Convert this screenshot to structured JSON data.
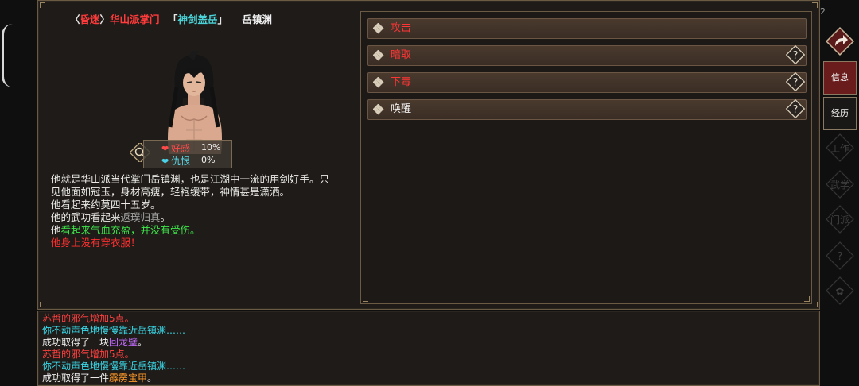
{
  "header": {
    "bracket_open": "〈",
    "status": "昏迷",
    "bracket_close": "〉",
    "sect_position": "华山派掌门",
    "title_open": "「",
    "title": "神剑盖岳",
    "title_close": "」",
    "name": "岳镇渊"
  },
  "stats": {
    "favor_label": "好感",
    "favor_value": "10%",
    "hatred_label": "仇恨",
    "hatred_value": "0%"
  },
  "description": {
    "intro": "他就是华山派当代掌门岳镇渊，也是江湖中一流的用剑好手。只见他面如冠玉，身材高瘦，轻袍缓带，神情甚是潇洒。",
    "age": "他看起来约莫四十五岁。",
    "martial_prefix": "他的武功看起来",
    "martial_level": "返璞归真",
    "martial_suffix": "。",
    "health_prefix": "他",
    "health_status": "看起来气血充盈，并没有受伤。",
    "clothing": "他身上没有穿衣服！"
  },
  "actions": [
    {
      "label": "攻击",
      "color": "red",
      "has_help": false
    },
    {
      "label": "暗取",
      "color": "red",
      "has_help": true
    },
    {
      "label": "下毒",
      "color": "red",
      "has_help": true
    },
    {
      "label": "唤醒",
      "color": "white",
      "has_help": true
    }
  ],
  "log": {
    "line1": "苏哲的邪气增加5点。",
    "line2": "你不动声色地慢慢靠近岳镇渊……",
    "line3_prefix": "成功取得了一块",
    "line3_item": "回龙璧",
    "line3_suffix": "。",
    "line4": "苏哲的邪气增加5点。",
    "line5": "你不动声色地慢慢靠近岳镇渊……",
    "line6_prefix": "成功取得了一件",
    "line6_item": "霹雳宝甲",
    "line6_suffix": "。"
  },
  "sidebar": {
    "corner_number": "2",
    "tab_info": "信息",
    "tab_history": "经历",
    "faded_items": [
      "工作",
      "武学",
      "门派",
      "?",
      "✿"
    ]
  },
  "colors": {
    "panel_bg": "#1e1b18",
    "border": "#6b5a44",
    "button_bg": "#3a2d24",
    "red_text": "#ff3535",
    "cyan_text": "#3ad8e8",
    "green_text": "#3ee84a",
    "active_tab": "#6a1c1c"
  }
}
